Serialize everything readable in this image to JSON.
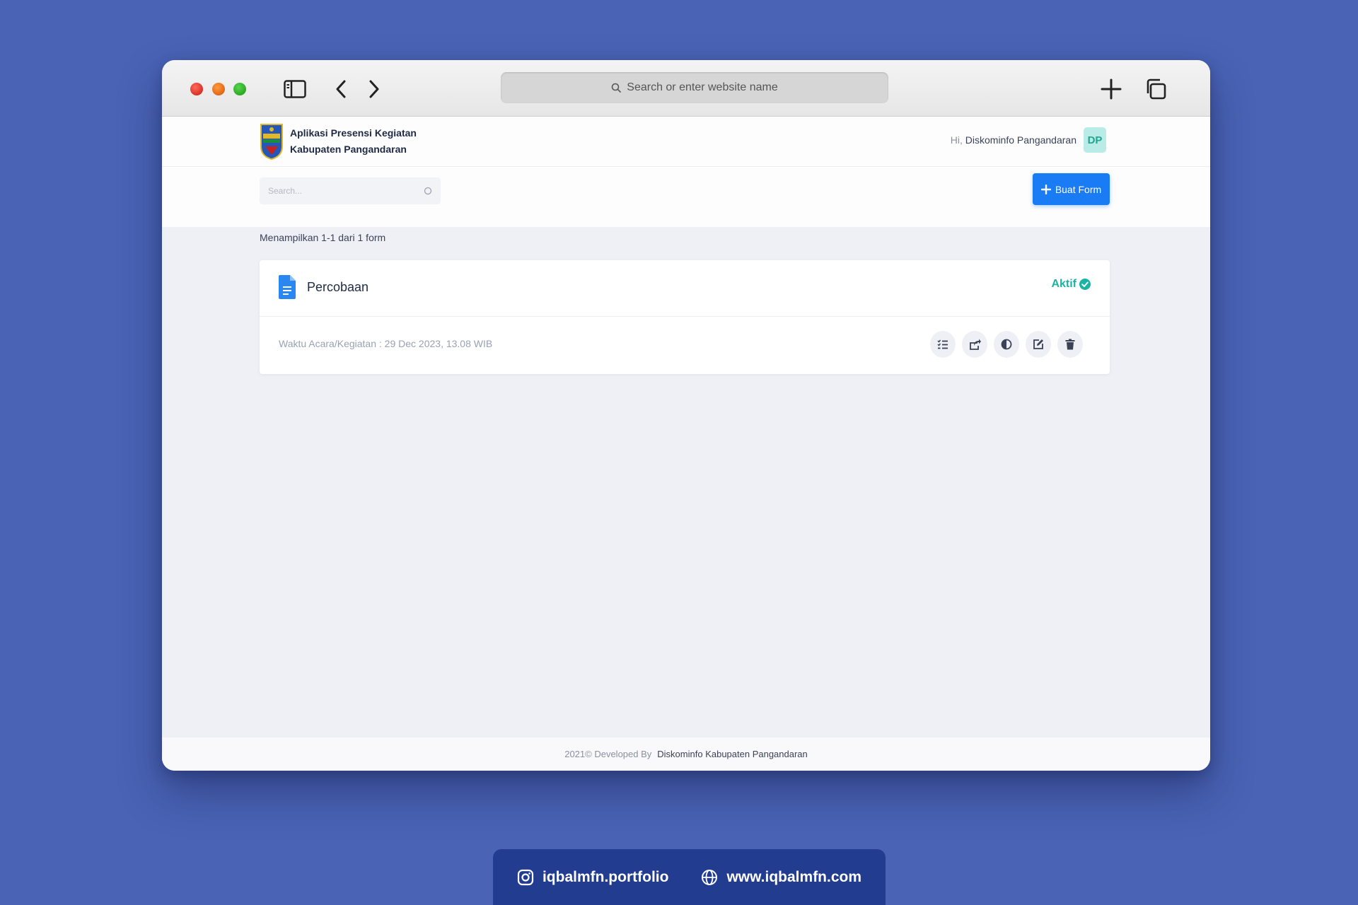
{
  "browser": {
    "address_placeholder": "Search or enter website name"
  },
  "app": {
    "brand_line1": "Aplikasi Presensi Kegiatan",
    "brand_line2": "Kabupaten Pangandaran",
    "user_greeting": "Hi,",
    "user_name": "Diskominfo Pangandaran",
    "user_initials": "DP",
    "search_placeholder": "Search...",
    "create_button_label": "Buat Form",
    "showing_text": "Menampilkan 1-1 dari 1 form"
  },
  "forms": [
    {
      "title": "Percobaan",
      "status": "Aktif",
      "event_time": "Waktu Acara/Kegiatan : 29 Dec 2023, 13.08 WIB"
    }
  ],
  "footer": {
    "prefix": "2021© Developed By",
    "org": "Diskominfo Kabupaten Pangandaran"
  },
  "social": {
    "instagram": "iqbalmfn.portfolio",
    "website": "www.iqbalmfn.com"
  },
  "colors": {
    "background": "#4a63b5",
    "primary": "#1a7cf5",
    "status_active": "#1bb3a3",
    "social_bar": "#223d8f"
  }
}
